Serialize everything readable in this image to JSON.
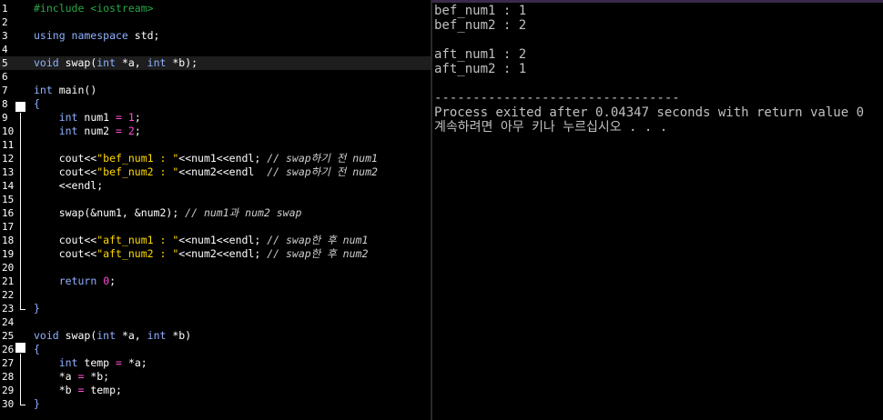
{
  "editor": {
    "lines": [
      {
        "n": "1",
        "t": [
          [
            "pp",
            "#include <iostream>"
          ]
        ]
      },
      {
        "n": "2",
        "t": []
      },
      {
        "n": "3",
        "t": [
          [
            "kw",
            "using namespace"
          ],
          [
            "id",
            " std;"
          ]
        ]
      },
      {
        "n": "4",
        "t": []
      },
      {
        "n": "5",
        "t": [
          [
            "kw",
            "void"
          ],
          [
            "id",
            " swap("
          ],
          [
            "kw",
            "int"
          ],
          [
            "id",
            " *a, "
          ],
          [
            "kw",
            "int"
          ],
          [
            "id",
            " *b);"
          ]
        ]
      },
      {
        "n": "6",
        "t": []
      },
      {
        "n": "7",
        "t": [
          [
            "kw",
            "int"
          ],
          [
            "id",
            " main()"
          ]
        ]
      },
      {
        "n": "8",
        "t": [
          [
            "kw",
            "{"
          ]
        ]
      },
      {
        "n": "9",
        "t": [
          [
            "id",
            "    "
          ],
          [
            "kw",
            "int"
          ],
          [
            "id",
            " num1 "
          ],
          [
            "op",
            "="
          ],
          [
            "id",
            " "
          ],
          [
            "num",
            "1"
          ],
          [
            "id",
            ";"
          ]
        ]
      },
      {
        "n": "10",
        "t": [
          [
            "id",
            "    "
          ],
          [
            "kw",
            "int"
          ],
          [
            "id",
            " num2 "
          ],
          [
            "op",
            "="
          ],
          [
            "id",
            " "
          ],
          [
            "num",
            "2"
          ],
          [
            "id",
            ";"
          ]
        ]
      },
      {
        "n": "11",
        "t": []
      },
      {
        "n": "12",
        "t": [
          [
            "id",
            "    cout<<"
          ],
          [
            "str",
            "\"bef_num1 : \""
          ],
          [
            "id",
            "<<num1<<endl; "
          ],
          [
            "cmt",
            "// swap하기 전 num1"
          ]
        ]
      },
      {
        "n": "13",
        "t": [
          [
            "id",
            "    cout<<"
          ],
          [
            "str",
            "\"bef_num2 : \""
          ],
          [
            "id",
            "<<num2<<endl  "
          ],
          [
            "cmt",
            "// swap하기 전 num2"
          ]
        ]
      },
      {
        "n": "14",
        "t": [
          [
            "id",
            "    <<endl;"
          ]
        ]
      },
      {
        "n": "15",
        "t": []
      },
      {
        "n": "16",
        "t": [
          [
            "id",
            "    swap(&num1, &num2); "
          ],
          [
            "cmt",
            "// num1과 num2 swap"
          ]
        ]
      },
      {
        "n": "17",
        "t": []
      },
      {
        "n": "18",
        "t": [
          [
            "id",
            "    cout<<"
          ],
          [
            "str",
            "\"aft_num1 : \""
          ],
          [
            "id",
            "<<num1<<endl; "
          ],
          [
            "cmt",
            "// swap한 후 num1"
          ]
        ]
      },
      {
        "n": "19",
        "t": [
          [
            "id",
            "    cout<<"
          ],
          [
            "str",
            "\"aft_num2 : \""
          ],
          [
            "id",
            "<<num2<<endl; "
          ],
          [
            "cmt",
            "// swap한 후 num2"
          ]
        ]
      },
      {
        "n": "20",
        "t": []
      },
      {
        "n": "21",
        "t": [
          [
            "id",
            "    "
          ],
          [
            "kw",
            "return"
          ],
          [
            "id",
            " "
          ],
          [
            "num",
            "0"
          ],
          [
            "id",
            ";"
          ]
        ]
      },
      {
        "n": "22",
        "t": []
      },
      {
        "n": "23",
        "t": [
          [
            "kw",
            "}"
          ]
        ]
      },
      {
        "n": "24",
        "t": []
      },
      {
        "n": "25",
        "t": [
          [
            "kw",
            "void"
          ],
          [
            "id",
            " swap("
          ],
          [
            "kw",
            "int"
          ],
          [
            "id",
            " *a, "
          ],
          [
            "kw",
            "int"
          ],
          [
            "id",
            " *b)"
          ]
        ]
      },
      {
        "n": "26",
        "t": [
          [
            "kw",
            "{"
          ]
        ]
      },
      {
        "n": "27",
        "t": [
          [
            "id",
            "    "
          ],
          [
            "kw",
            "int"
          ],
          [
            "id",
            " temp "
          ],
          [
            "op",
            "="
          ],
          [
            "id",
            " *a;"
          ]
        ]
      },
      {
        "n": "28",
        "t": [
          [
            "id",
            "    *a "
          ],
          [
            "op",
            "="
          ],
          [
            "id",
            " *b;"
          ]
        ]
      },
      {
        "n": "29",
        "t": [
          [
            "id",
            "    *b "
          ],
          [
            "op",
            "="
          ],
          [
            "id",
            " temp;"
          ]
        ]
      },
      {
        "n": "30",
        "t": [
          [
            "kw",
            "}"
          ]
        ]
      }
    ],
    "current_line": "5"
  },
  "console": {
    "lines": [
      "bef_num1 : 1",
      "bef_num2 : 2",
      "",
      "aft_num1 : 2",
      "aft_num2 : 1",
      "",
      "--------------------------------",
      "Process exited after 0.04347 seconds with return value 0",
      "계속하려면 아무 키나 누르십시오 . . ."
    ]
  },
  "colors": {
    "keyword": "#8fb1ff",
    "preprocessor": "#28a745",
    "string": "#ffd900",
    "number": "#ff4fd8",
    "comment": "#cfcfcf",
    "console_text": "#c0c0c0"
  }
}
